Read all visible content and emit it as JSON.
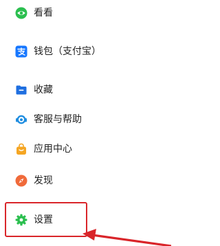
{
  "menu": {
    "items": [
      {
        "label": "看看",
        "icon": "eye-icon",
        "color": "#2bbf4f"
      },
      {
        "label": "钱包（支付宝）",
        "icon": "alipay-icon",
        "color": "#1677ff"
      },
      {
        "label": "收藏",
        "icon": "folder-icon",
        "color": "#1f6fe0"
      },
      {
        "label": "客服与帮助",
        "icon": "headset-icon",
        "color": "#1f8de0"
      },
      {
        "label": "应用中心",
        "icon": "shopping-bag-icon",
        "color": "#f5a623"
      },
      {
        "label": "发现",
        "icon": "compass-icon",
        "color": "#f06a3a"
      },
      {
        "label": "设置",
        "icon": "gear-icon",
        "color": "#2bbf4f"
      }
    ]
  },
  "annotation": {
    "highlight_color": "#d9252a"
  }
}
